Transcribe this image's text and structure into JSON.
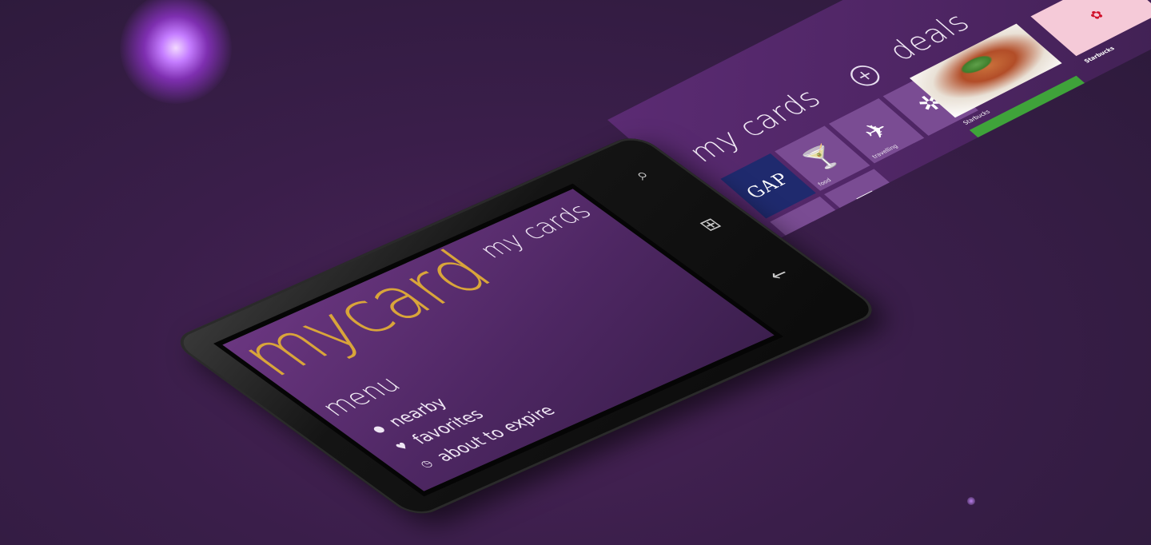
{
  "app": {
    "logo": "mycard",
    "menu_title": "menu",
    "menu_items": [
      {
        "label": "nearby",
        "icon": "location-pin-icon"
      },
      {
        "label": "favorites",
        "icon": "heart-icon"
      },
      {
        "label": "about to expire",
        "icon": "clock-icon"
      }
    ]
  },
  "panel": {
    "my_cards_label": "my cards",
    "deals_label": "deals",
    "tiles": [
      {
        "label": "GAP",
        "icon": "",
        "caption": ""
      },
      {
        "label": "",
        "icon": "cocktail-icon",
        "caption": "food"
      },
      {
        "label": "",
        "icon": "airplane-icon",
        "caption": "travelling"
      },
      {
        "label": "",
        "icon": "palm-tree-icon",
        "caption": ""
      },
      {
        "label": "",
        "icon": "shopping-bag-icon",
        "caption": ""
      },
      {
        "label": "",
        "icon": "list-icon",
        "caption": ""
      }
    ],
    "deals": [
      {
        "name": "food-deal",
        "caption": "Starbucks"
      },
      {
        "name": "holiday-inn-deal",
        "text": "Holiday Inn",
        "caption": "Starbucks"
      },
      {
        "name": "pink-deal",
        "caption": "Starbucks"
      }
    ]
  },
  "colors": {
    "accent": "#d9a53a",
    "background": "#3a1e4a",
    "holiday_green": "#3fa33a"
  }
}
